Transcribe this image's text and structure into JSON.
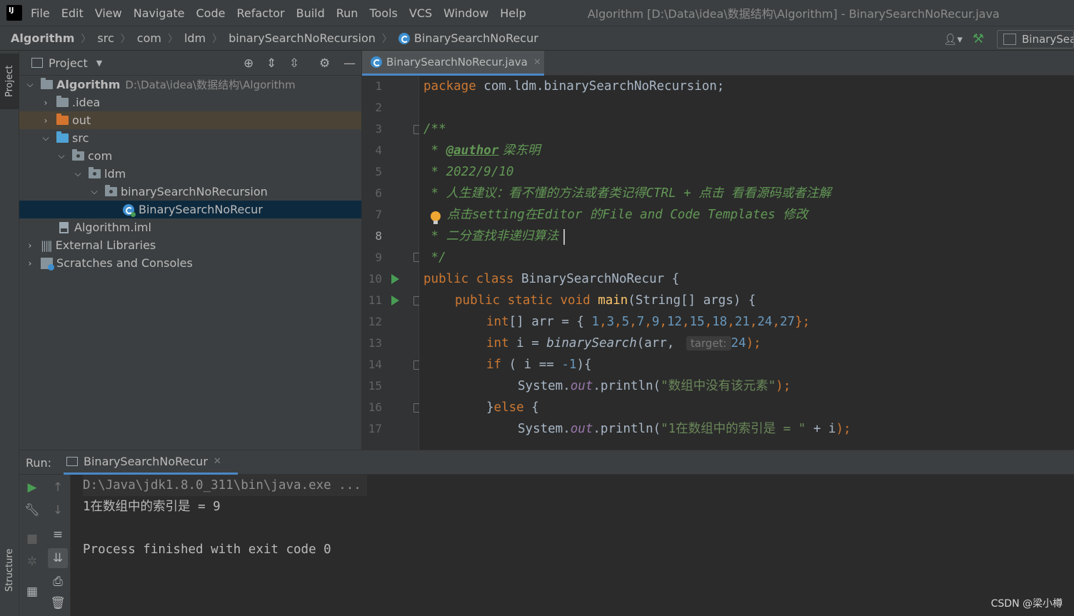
{
  "menu": {
    "items": [
      "File",
      "Edit",
      "View",
      "Navigate",
      "Code",
      "Refactor",
      "Build",
      "Run",
      "Tools",
      "VCS",
      "Window",
      "Help"
    ],
    "window_title": "Algorithm [D:\\Data\\idea\\数据结构\\Algorithm] - BinarySearchNoRecur.java"
  },
  "breadcrumb": [
    "Algorithm",
    "src",
    "com",
    "ldm",
    "binarySearchNoRecursion",
    "BinarySearchNoRecur"
  ],
  "nav": {
    "run_config": "BinarySea"
  },
  "tool_strip": {
    "project": "Project",
    "structure": "Structure"
  },
  "project": {
    "title": "Project",
    "tree": [
      {
        "label": "Algorithm",
        "path": "D:\\Data\\idea\\数据结构\\Algorithm"
      },
      {
        "label": ".idea"
      },
      {
        "label": "out"
      },
      {
        "label": "src"
      },
      {
        "label": "com"
      },
      {
        "label": "ldm"
      },
      {
        "label": "binarySearchNoRecursion"
      },
      {
        "label": "BinarySearchNoRecur"
      },
      {
        "label": "Algorithm.iml"
      },
      {
        "label": "External Libraries"
      },
      {
        "label": "Scratches and Consoles"
      }
    ]
  },
  "editor": {
    "tab": "BinarySearchNoRecur.java",
    "current_line": 8,
    "line_numbers": [
      "1",
      "2",
      "3",
      "4",
      "5",
      "6",
      "7",
      "8",
      "9",
      "10",
      "11",
      "12",
      "13",
      "14",
      "15",
      "16",
      "17"
    ],
    "code": {
      "l1_kw": "package",
      "l1_rest": " com.ldm.binarySearchNoRecursion;",
      "l3": "/**",
      "l4_star": " * ",
      "l4_tag": "@author",
      "l4_rest": " 梁东明",
      "l5": " * 2022/9/10",
      "l6": " * 人生建议：看不懂的方法或者类记得CTRL + 点击 看看源码或者注解",
      "l7": "点击setting在Editor 的File and Code Templates 修改",
      "l8": " * 二分查找非递归算法",
      "l9": " */",
      "l10_kw": "public class",
      "l10_rest": " BinarySearchNoRecur {",
      "l11_kw": "public static void",
      "l11_fn": "main",
      "l11_rest": "(String[] args) {",
      "l12_kw": "int",
      "l12_a": "[] arr = { ",
      "l12_nums": [
        "1",
        "3",
        "5",
        "7",
        "9",
        "12",
        "15",
        "18",
        "21",
        "24",
        "27"
      ],
      "l12_end": "};",
      "l13_kw": "int",
      "l13_a": " i = ",
      "l13_fn": "binarySearch",
      "l13_b": "(arr, ",
      "l13_hint": "target:",
      "l13_num": "24",
      "l13_end": ");",
      "l14_kw": "if",
      "l14_a": " ( i == ",
      "l14_num": "-1",
      "l14_b": "){",
      "l15_a": "System.",
      "l15_stat": "out",
      "l15_b": ".println(",
      "l15_str": "\"数组中没有该元素\"",
      "l15_end": ");",
      "l16_a": "}",
      "l16_kw": "else",
      "l16_b": " {",
      "l17_a": "System.",
      "l17_stat": "out",
      "l17_b": ".println(",
      "l17_str": "\"1在数组中的索引是 = \"",
      "l17_c": " + i",
      "l17_end": ");"
    }
  },
  "run": {
    "label": "Run:",
    "tab": "BinarySearchNoRecur",
    "console": [
      "D:\\Java\\jdk1.8.0_311\\bin\\java.exe ...",
      "1在数组中的索引是 = 9",
      "",
      "Process finished with exit code 0"
    ]
  },
  "watermark": "CSDN @梁小樽",
  "colors": {
    "keyword": "#cc7832",
    "string": "#6a8759",
    "number": "#6897bb",
    "comment": "#629755",
    "selection": "#0d293e",
    "accent": "#4a88c7"
  }
}
